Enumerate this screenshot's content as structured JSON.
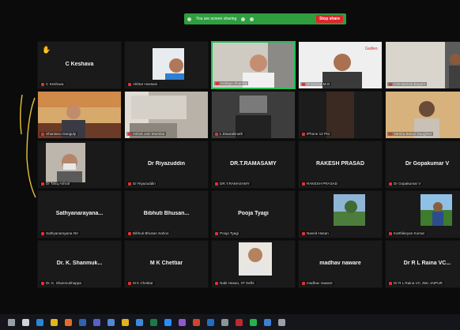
{
  "share_banner": {
    "text": "You are screen sharing",
    "stop_label": "Stop share",
    "color": "#2f9e3f",
    "stop_color": "#e0252b"
  },
  "tiles": [
    {
      "center": "C Keshava",
      "label": "C Keshava",
      "hand": true
    },
    {
      "center": "",
      "label": "Akhtar Hussain",
      "photo": "man-blue-shirt"
    },
    {
      "center": "",
      "label": "Hridaye Sharma",
      "photo": "man-white-shirt",
      "active": true
    },
    {
      "center": "",
      "label": "Dr.Kumar M.G",
      "photo": "man-speaking"
    },
    {
      "center": "",
      "label": "CIN Mariola Begum",
      "photo": "woman-room"
    },
    {
      "center": "",
      "label": "Shantanu Ganguly",
      "photo": "man-outdoor"
    },
    {
      "center": "",
      "label": "Ashok Jain Mumbai",
      "photo": "curtain-room"
    },
    {
      "center": "",
      "label": "L Dwarakinath",
      "photo": "dark-room"
    },
    {
      "center": "",
      "label": "iPhone 12 Pro",
      "photo": "dark-figure"
    },
    {
      "center": "",
      "label": "Varsha Belani Daughter",
      "photo": "woman-wall"
    },
    {
      "center": "",
      "label": "Dr Tariq Ashraf",
      "photo": "man-mask"
    },
    {
      "center": "Dr Riyazuddin",
      "label": "Dr Riyazuddin"
    },
    {
      "center": "DR.T.RAMASAMY",
      "label": "DR.T.RAMASAMY"
    },
    {
      "center": "RAKESH PRASAD",
      "label": "RAKESH PRASAD"
    },
    {
      "center": "Dr Gopakumar V",
      "label": "Dr Gopakumar V"
    },
    {
      "center": "Sathyanarayana...",
      "label": "Sathyanarayana NV"
    },
    {
      "center": "Bibhuti Bhusan...",
      "label": "Bibhuti Bhusan Sahoo"
    },
    {
      "center": "Pooja Tyagi",
      "label": "Pooja Tyagi"
    },
    {
      "center": "",
      "label": "Naved Hasan",
      "photo": "tree-photo"
    },
    {
      "center": "",
      "label": "Karthikeyan Kumar",
      "photo": "man-tree"
    },
    {
      "center": "Dr. K. Shanmuk...",
      "label": "Dr. K. Shanmukhappa"
    },
    {
      "center": "M K Chettiar",
      "label": "M K Chettiar"
    },
    {
      "center": "",
      "label": "Nabi Hasan, IIT Delhi",
      "photo": "man-portrait"
    },
    {
      "center": "madhav naware",
      "label": "madhav naware"
    },
    {
      "center": "Dr R L Raina VC...",
      "label": "Dr R L Raina VC JNU JAIPUR"
    }
  ],
  "taskbar": {
    "icons": [
      "start-icon",
      "search-icon",
      "edge-icon",
      "chrome-icon",
      "firefox-icon",
      "word-icon",
      "teams-icon",
      "store-icon",
      "folder-icon",
      "mail-icon",
      "excel-icon",
      "zoom-icon",
      "media-icon",
      "powerpoint-icon",
      "outlook-icon",
      "settings-icon",
      "pdf-icon",
      "whatsapp-icon",
      "photos-icon",
      "network-icon"
    ],
    "colors": [
      "#9aa0a8",
      "#cfd3d8",
      "#2a86d6",
      "#e2b31c",
      "#e86a2b",
      "#2f62b0",
      "#5b5fc7",
      "#4f8ad6",
      "#e2b31c",
      "#3b8bd8",
      "#1d7a44",
      "#2d8cff",
      "#8f5ad0",
      "#d0452b",
      "#1f6fc3",
      "#8e9299",
      "#c0282d",
      "#25b24a",
      "#3d7fd0",
      "#9aa0a8"
    ]
  }
}
